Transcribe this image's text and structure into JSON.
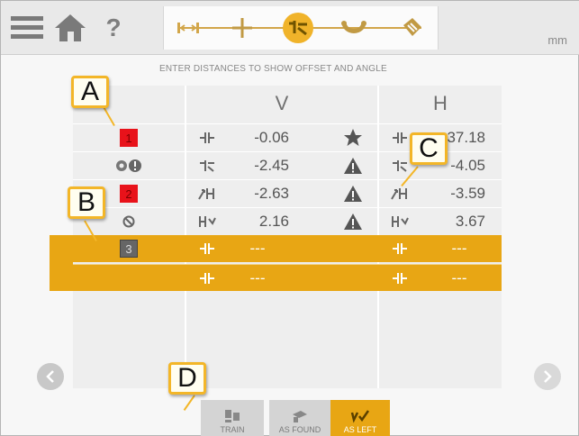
{
  "topbar": {
    "units": "mm",
    "help_glyph": "?",
    "icons": [
      "menu-icon",
      "home-icon",
      "help-icon"
    ],
    "steps": [
      "dimensions-icon",
      "measure-icon",
      "results-icon",
      "correct-icon",
      "report-icon"
    ],
    "active_step": 2
  },
  "instruction": "ENTER DISTANCES TO SHOW OFFSET AND ANGLE",
  "table": {
    "col_v": "V",
    "col_h": "H",
    "rows": [
      {
        "badge": "1",
        "v": "-0.06",
        "status": "star-icon",
        "h": "37.18"
      },
      {
        "badge": "",
        "v": "-2.45",
        "status": "warning-icon",
        "h": "-4.05"
      },
      {
        "badge": "2",
        "v": "-2.63",
        "status": "warning-icon",
        "h": "-3.59"
      },
      {
        "badge": "",
        "v": "2.16",
        "status": "warning-icon",
        "h": "3.67"
      },
      {
        "badge": "3",
        "v": "---",
        "status": "",
        "h": "---"
      },
      {
        "badge": "",
        "v": "---",
        "status": "",
        "h": "---"
      }
    ]
  },
  "callouts": {
    "a": "A",
    "b": "B",
    "c": "C",
    "d": "D"
  },
  "bottom": {
    "train_label": "TRAIN",
    "as_found_label": "AS FOUND",
    "as_left_label": "AS LEFT"
  },
  "colors": {
    "accent": "#e8a614",
    "callout_border": "#f3b628",
    "badge_red": "#e8121a",
    "badge_gray": "#666666"
  }
}
